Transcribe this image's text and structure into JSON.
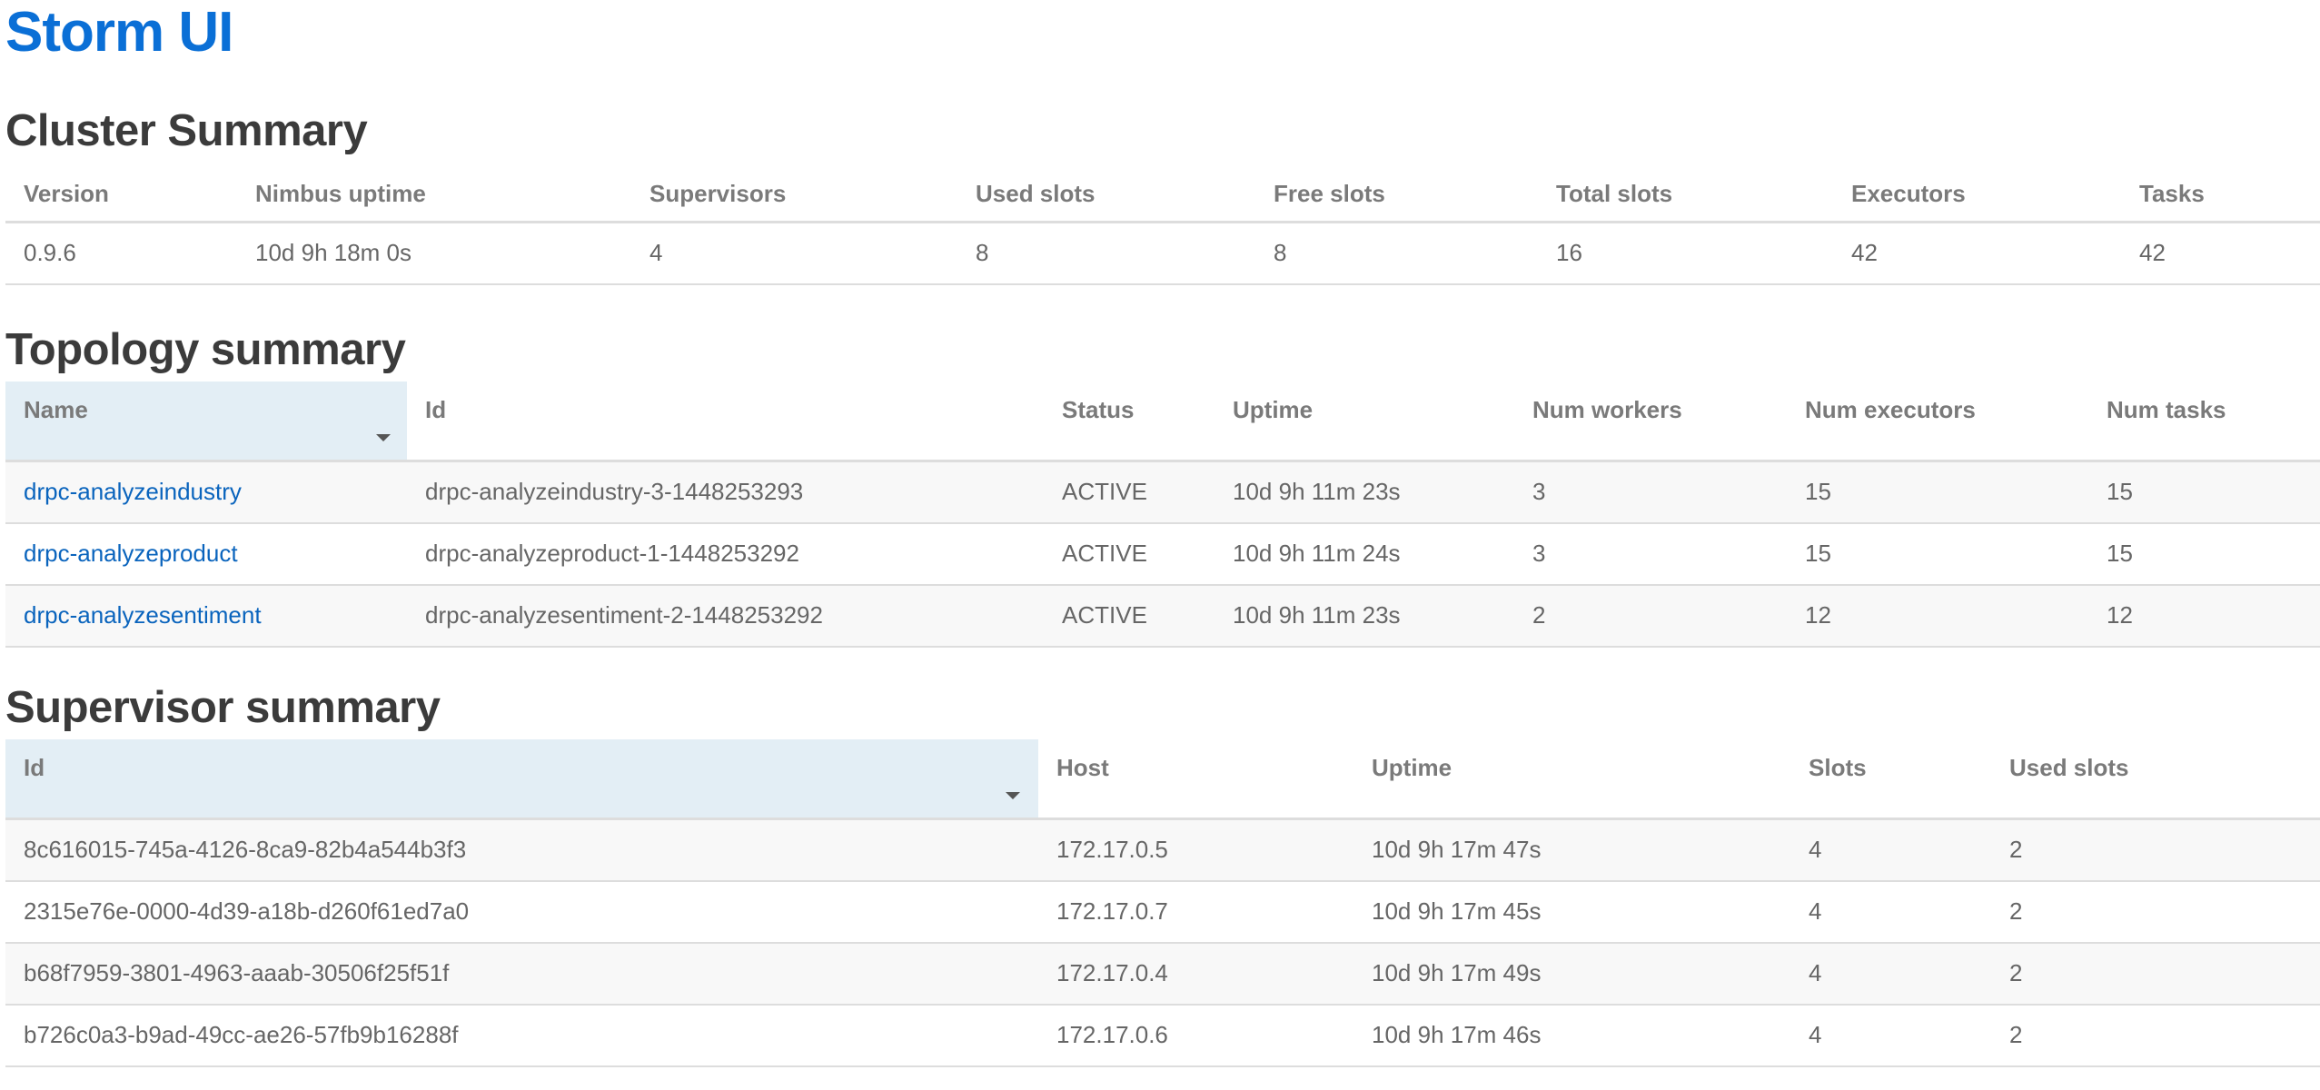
{
  "app": {
    "title": "Storm UI"
  },
  "cluster_summary": {
    "title": "Cluster Summary",
    "columns": [
      "Version",
      "Nimbus uptime",
      "Supervisors",
      "Used slots",
      "Free slots",
      "Total slots",
      "Executors",
      "Tasks"
    ],
    "row": [
      "0.9.6",
      "10d 9h 18m 0s",
      "4",
      "8",
      "8",
      "16",
      "42",
      "42"
    ]
  },
  "topology_summary": {
    "title": "Topology summary",
    "sorted_column": "Name",
    "columns": [
      "Name",
      "Id",
      "Status",
      "Uptime",
      "Num workers",
      "Num executors",
      "Num tasks"
    ],
    "rows": [
      [
        "drpc-analyzeindustry",
        "drpc-analyzeindustry-3-1448253293",
        "ACTIVE",
        "10d 9h 11m 23s",
        "3",
        "15",
        "15"
      ],
      [
        "drpc-analyzeproduct",
        "drpc-analyzeproduct-1-1448253292",
        "ACTIVE",
        "10d 9h 11m 24s",
        "3",
        "15",
        "15"
      ],
      [
        "drpc-analyzesentiment",
        "drpc-analyzesentiment-2-1448253292",
        "ACTIVE",
        "10d 9h 11m 23s",
        "2",
        "12",
        "12"
      ]
    ]
  },
  "supervisor_summary": {
    "title": "Supervisor summary",
    "sorted_column": "Id",
    "columns": [
      "Id",
      "Host",
      "Uptime",
      "Slots",
      "Used slots"
    ],
    "rows": [
      [
        "8c616015-745a-4126-8ca9-82b4a544b3f3",
        "172.17.0.5",
        "10d 9h 17m 47s",
        "4",
        "2"
      ],
      [
        "2315e76e-0000-4d39-a18b-d260f61ed7a0",
        "172.17.0.7",
        "10d 9h 17m 45s",
        "4",
        "2"
      ],
      [
        "b68f7959-3801-4963-aaab-30506f25f51f",
        "172.17.0.4",
        "10d 9h 17m 49s",
        "4",
        "2"
      ],
      [
        "b726c0a3-b9ad-49cc-ae26-57fb9b16288f",
        "172.17.0.6",
        "10d 9h 17m 46s",
        "4",
        "2"
      ]
    ]
  },
  "colors": {
    "brand": "#0a6fd6",
    "link": "#0a64bd",
    "sorted_header_bg": "#e3eef5",
    "stripe_bg": "#f8f8f8",
    "rule": "#dddddd"
  },
  "icons": {
    "sort": "caret-down-icon"
  }
}
